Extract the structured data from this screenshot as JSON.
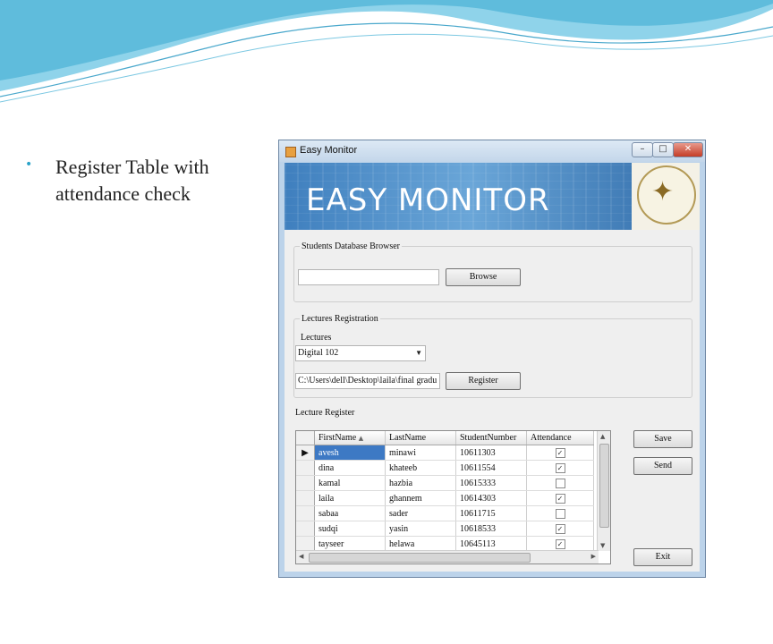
{
  "slide": {
    "bullet": "•",
    "text": "Register Table with attendance check"
  },
  "window": {
    "title": "Easy Monitor",
    "min": "–",
    "max": "□",
    "close": "✕"
  },
  "banner": {
    "title": "EASY MONITOR"
  },
  "students_db": {
    "legend": "Students Database Browser",
    "path_value": "",
    "browse_label": "Browse"
  },
  "lectures": {
    "legend": "Lectures Registration",
    "label": "Lectures",
    "selected": "Digital 102",
    "path_value": "C:\\Users\\dell\\Desktop\\laila\\final gradu",
    "register_label": "Register"
  },
  "lecture_register": {
    "label": "Lecture Register",
    "columns": [
      "FirstName",
      "LastName",
      "StudentNumber",
      "Attendance"
    ],
    "sort_indicator": "▲",
    "rows": [
      {
        "first": "avesh",
        "last": "minawi",
        "number": "10611303",
        "attendance": true
      },
      {
        "first": "dina",
        "last": "khateeb",
        "number": "10611554",
        "attendance": true
      },
      {
        "first": "kamal",
        "last": "hazbia",
        "number": "10615333",
        "attendance": false
      },
      {
        "first": "laila",
        "last": "ghannem",
        "number": "10614303",
        "attendance": true
      },
      {
        "first": "sabaa",
        "last": "sader",
        "number": "10611715",
        "attendance": false
      },
      {
        "first": "sudqi",
        "last": "yasin",
        "number": "10618533",
        "attendance": true
      },
      {
        "first": "tayseer",
        "last": "helawa",
        "number": "10645113",
        "attendance": true
      }
    ],
    "current_row_marker": "▶"
  },
  "actions": {
    "save_label": "Save",
    "send_label": "Send",
    "exit_label": "Exit"
  },
  "colors": {
    "selection": "#3d79c4",
    "bullet": "#2aa3c8"
  }
}
